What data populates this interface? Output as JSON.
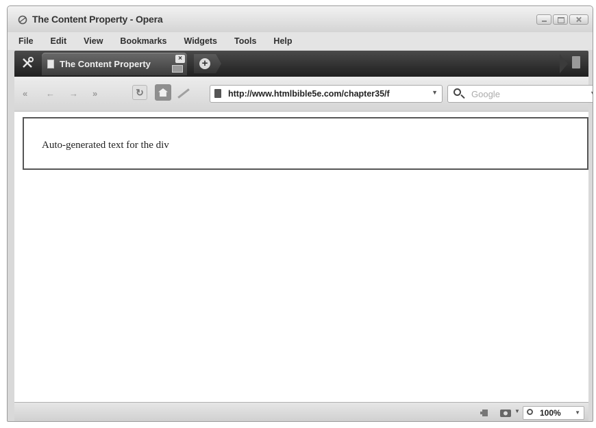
{
  "window": {
    "title": "The Content Property - Opera"
  },
  "menu": [
    "File",
    "Edit",
    "View",
    "Bookmarks",
    "Widgets",
    "Tools",
    "Help"
  ],
  "tabs": [
    {
      "label": "The Content Property",
      "close": "×"
    }
  ],
  "newtab": {
    "icon": "plus-icon"
  },
  "nav": {
    "rewind": "«",
    "back": "←",
    "forward": "→",
    "fastforward": "»",
    "reload": "↻"
  },
  "address": {
    "url": "http://www.htmlbible5e.com/chapter35/f"
  },
  "search": {
    "placeholder": "Google"
  },
  "page": {
    "text": "Auto-generated text for the div"
  },
  "status": {
    "zoom": "100%"
  }
}
